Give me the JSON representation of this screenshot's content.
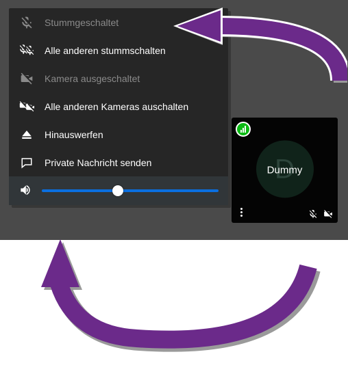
{
  "menu": {
    "items": [
      {
        "label": "Stummgeschaltet",
        "icon": "mic-muted-icon",
        "disabled": true
      },
      {
        "label": "Alle anderen stummschalten",
        "icon": "mic-mute-all-icon",
        "disabled": false
      },
      {
        "label": "Kamera ausgeschaltet",
        "icon": "camera-off-icon",
        "disabled": true
      },
      {
        "label": "Alle anderen Kameras auschalten",
        "icon": "camera-off-all-icon",
        "disabled": false
      },
      {
        "label": "Hinauswerfen",
        "icon": "eject-icon",
        "disabled": false
      },
      {
        "label": "Private Nachricht senden",
        "icon": "chat-icon",
        "disabled": false
      }
    ],
    "volume": {
      "value": 43,
      "min": 0,
      "max": 100
    }
  },
  "participant": {
    "name": "Dummy",
    "avatar_initial": "D",
    "connection_quality": "good",
    "mic_muted": true,
    "camera_off": true
  },
  "colors": {
    "accent": "#0a6fe0",
    "quality_good": "#0bb914",
    "annotation": "#6b2a8a"
  }
}
